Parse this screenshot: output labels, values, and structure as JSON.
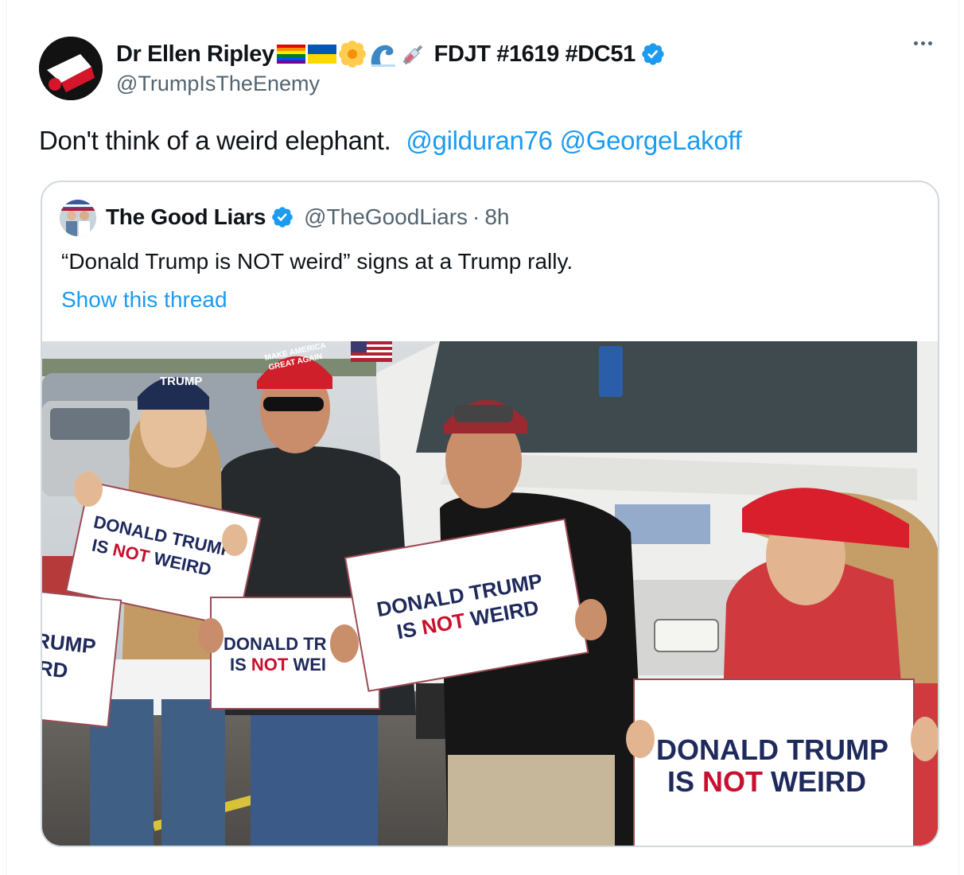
{
  "author": {
    "display_name": "Dr Ellen Ripley",
    "name_suffix": "FDJT #1619 #DC51",
    "handle": "@TrumpIsTheEnemy",
    "emojis": [
      "rainbow-flag",
      "ukraine-flag",
      "blossom",
      "wave",
      "syringe"
    ]
  },
  "tweet": {
    "text": "Don't think of a weird elephant.",
    "mentions": [
      "@gilduran76",
      "@GeorgeLakoff"
    ]
  },
  "quoted": {
    "display_name": "The Good Liars",
    "handle": "@TheGoodLiars",
    "separator": "·",
    "time": "8h",
    "text": "“Donald Trump is NOT weird” signs at a Trump rally.",
    "show_thread": "Show this thread"
  },
  "photo": {
    "hats": {
      "trump": "TRUMP",
      "maga_line1": "MAKE AMERICA",
      "maga_line2": "GREAT AGAIN"
    },
    "signs": [
      {
        "line1": "DONALD TRUMP",
        "pre": "IS ",
        "not": "NOT",
        "post": " WEIRD"
      },
      {
        "line1": "RUMP",
        "line2": "IRD"
      },
      {
        "line1": "DONALD TR",
        "pre": "IS ",
        "not": "NOT",
        "post": " WEI"
      },
      {
        "line1": "DONALD TRUMP",
        "pre": "IS ",
        "not": "NOT",
        "post": " WEIRD"
      },
      {
        "line1": "DONALD TRUMP",
        "pre": "IS ",
        "not": "NOT",
        "post": " WEIRD"
      }
    ]
  },
  "colors": {
    "accent": "#1d9bf0",
    "text": "#0f1419",
    "muted": "#536471",
    "border": "#cfd9de",
    "sign_red": "#c8102e",
    "sign_navy": "#1f2a5c"
  }
}
